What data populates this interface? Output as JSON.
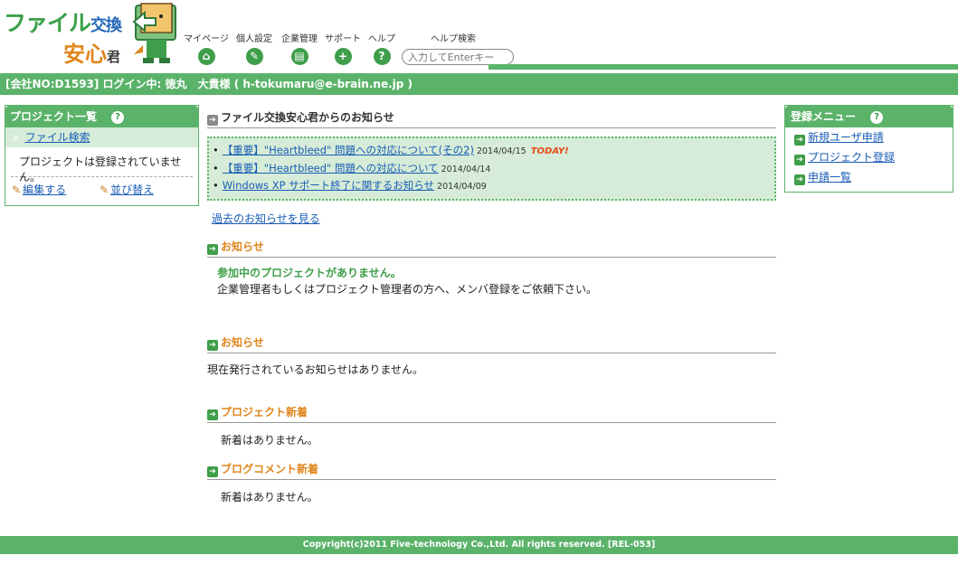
{
  "logo": {
    "line1_a": "ファイル",
    "line1_b": "交換",
    "line2_a": "安心",
    "line2_b": "君"
  },
  "nav": [
    {
      "label": "マイページ",
      "icon": "home-icon",
      "glyph": "⌂"
    },
    {
      "label": "個人設定",
      "icon": "user-settings-icon",
      "glyph": "✎"
    },
    {
      "label": "企業管理",
      "icon": "company-doc-icon",
      "glyph": "▤"
    },
    {
      "label": "サポート",
      "icon": "support-plus-icon",
      "glyph": "+"
    },
    {
      "label": "ヘルプ",
      "icon": "help-icon",
      "glyph": "?"
    }
  ],
  "help_search": {
    "label": "ヘルプ検索",
    "placeholder": "入力してEnterキー"
  },
  "userbar": {
    "text": "[会社NO:D1593] ログイン中: 徳丸　大貴様 ( h-tokumaru@e-brain.ne.jp )"
  },
  "left_panel": {
    "title": "プロジェクト一覧",
    "help": "?",
    "search_link": "ファイル検索",
    "empty_msg": "プロジェクトは登録されていません。",
    "edit_link": "編集する",
    "sort_link": "並び替え"
  },
  "center": {
    "news_title": "ファイル交換安心君からのお知らせ",
    "news": [
      {
        "title": "【重要】\"Heartbleed\" 問題への対応について(その2)",
        "date": "2014/04/15",
        "badge": "TODAY!"
      },
      {
        "title": "【重要】\"Heartbleed\" 問題への対応について",
        "date": "2014/04/14",
        "badge": ""
      },
      {
        "title": "Windows XP サポート終了に関するお知らせ",
        "date": "2014/04/09",
        "badge": ""
      }
    ],
    "past_link": "過去のお知らせを見る",
    "sec1_title": "お知らせ",
    "sec1_highlight": "参加中のプロジェクトがありません。",
    "sec1_text": "企業管理者もしくはプロジェクト管理者の方へ、メンバ登録をご依頼下さい。",
    "sec2_title": "お知らせ",
    "sec2_text": "現在発行されているお知らせはありません。",
    "sec3_title": "プロジェクト新着",
    "sec3_text": "新着はありません。",
    "sec4_title": "ブログコメント新着",
    "sec4_text": "新着はありません。"
  },
  "right_panel": {
    "title": "登録メニュー",
    "help": "?",
    "items": [
      "新規ユーザ申請",
      "プロジェクト登録",
      "申請一覧"
    ]
  },
  "footer": {
    "text": "Copyright(c)2011 Five-technology Co.,Ltd. All rights reserved. [REL-053]"
  },
  "colors": {
    "accent_green": "#5bb36a",
    "link_blue": "#1a5db5",
    "section_orange": "#e0851a",
    "today_red": "#e84a1a"
  }
}
